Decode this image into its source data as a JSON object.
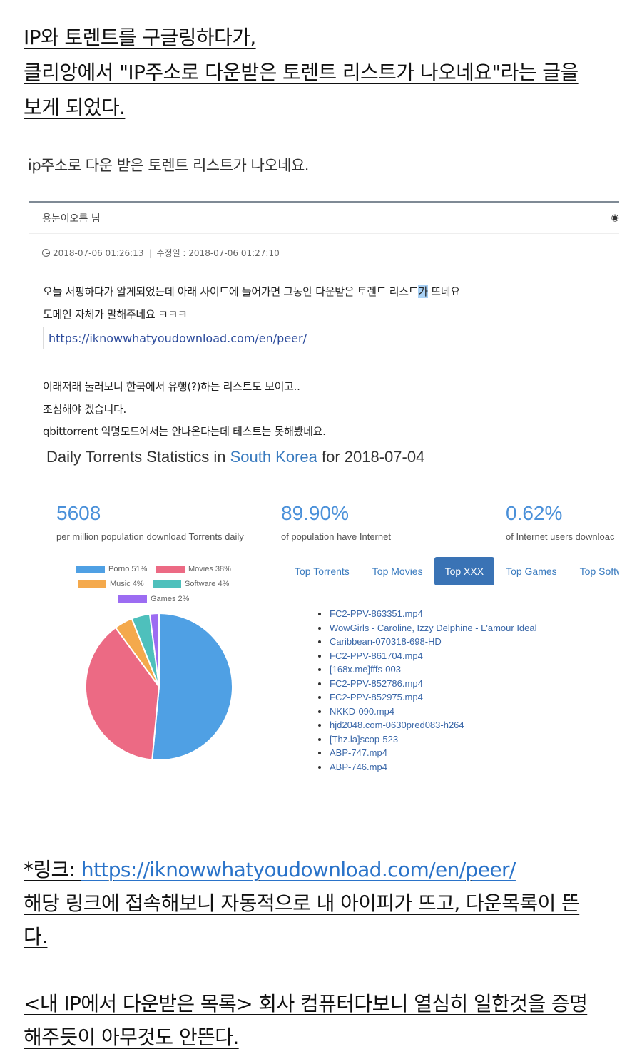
{
  "intro": {
    "line1": "IP와 토렌트를 구글링하다가,",
    "line2": "클리앙에서 \"IP주소로 다운받은 토렌트 리스트가 나오네요\"라는 글을",
    "line3": "보게 되었다."
  },
  "quote_title": "ip주소로 다운 받은 토렌트 리스트가 나오네요.",
  "post": {
    "author": "용눈이오름 님",
    "eye_icon": "eye-icon",
    "created": "2018-07-06 01:26:13",
    "modified": "수정일 : 2018-07-06 01:27:10",
    "p1_before": "오늘 서핑하다가 알게되었는데 아래 사이트에 들어가면 그동안 다운받은 토렌트 리스트",
    "p1_highlight": "가",
    "p1_after": " 뜨네요",
    "p2": "도메인 자체가 말해주네요 ㅋㅋㅋ",
    "link": "https://iknowwhatyoudownload.com/en/peer/",
    "p3": "이래저래 눌러보니 한국에서 유행(?)하는 리스트도 보이고..",
    "p4": "조심해야 겠습니다.",
    "p5": "qbittorrent 익명모드에서는 안나온다는데 테스트는 못해봤네요."
  },
  "stats": {
    "title_prefix": "Daily Torrents Statistics in ",
    "country": "South Korea",
    "title_suffix": " for 2018-07-04",
    "items": [
      {
        "value": "5608",
        "label": "per million population download Torrents daily"
      },
      {
        "value": "89.90%",
        "label": "of population have Internet"
      },
      {
        "value": "0.62%",
        "label": "of Internet users downloac"
      }
    ]
  },
  "tabs": [
    "Top Torrents",
    "Top Movies",
    "Top XXX",
    "Top Games",
    "Top Softwa"
  ],
  "active_tab": "Top XXX",
  "torrents": [
    "FC2-PPV-863351.mp4",
    "WowGirls - Caroline, Izzy Delphine - L'amour Ideal",
    "Caribbean-070318-698-HD",
    "FC2-PPV-861704.mp4",
    "[168x.me]fffs-003",
    "FC2-PPV-852786.mp4",
    "FC2-PPV-852975.mp4",
    "NKKD-090.mp4",
    "hjd2048.com-0630pred083-h264",
    "[Thz.la]scop-523",
    "ABP-747.mp4",
    "ABP-746.mp4"
  ],
  "chart_data": {
    "type": "pie",
    "categories": [
      "Porno",
      "Movies",
      "Music",
      "Software",
      "Games"
    ],
    "values": [
      51,
      38,
      4,
      4,
      2
    ],
    "legend_labels": [
      "Porno 51%",
      "Movies 38%",
      "Music 4%",
      "Software 4%",
      "Games 2%"
    ],
    "colors": [
      "#4fa0e4",
      "#ec6a84",
      "#f4a94c",
      "#4ec0bc",
      "#9c6cf2"
    ],
    "legend_position": "top"
  },
  "outro": {
    "link_prefix": "*링크: ",
    "link": "https://iknowwhatyoudownload.com/en/peer/",
    "line2": "해당 링크에 접속해보니 자동적으로 내 아이피가 뜨고, 다운목록이 뜬",
    "line3": "다.",
    "line4": "<내 IP에서 다운받은 목록> 회사 컴퓨터다보니 열심히 일한것을 증명",
    "line5": "해주듯이 아무것도 안뜬다."
  }
}
